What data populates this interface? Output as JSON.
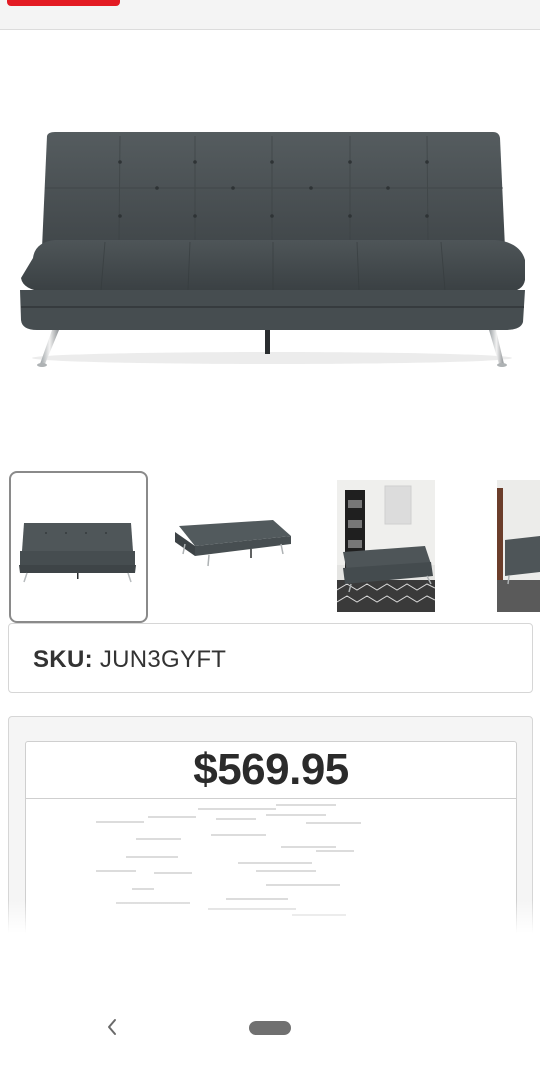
{
  "product": {
    "sku_label": "SKU:",
    "sku_value": "JUN3GYFT",
    "price": "$569.95",
    "images": [
      {
        "name": "sofa-front-view",
        "selected": true
      },
      {
        "name": "sofa-bed-flat-view",
        "selected": false
      },
      {
        "name": "sofa-room-scene",
        "selected": false
      },
      {
        "name": "sofa-room-scene-partial",
        "selected": false
      }
    ]
  },
  "colors": {
    "brand_red": "#e31b23",
    "sofa_fabric": "#4b5254",
    "thumb_selected_border": "#8a8a8a"
  },
  "navbar": {
    "back_icon": "chevron-left-icon",
    "home_icon": "home-pill-icon"
  }
}
